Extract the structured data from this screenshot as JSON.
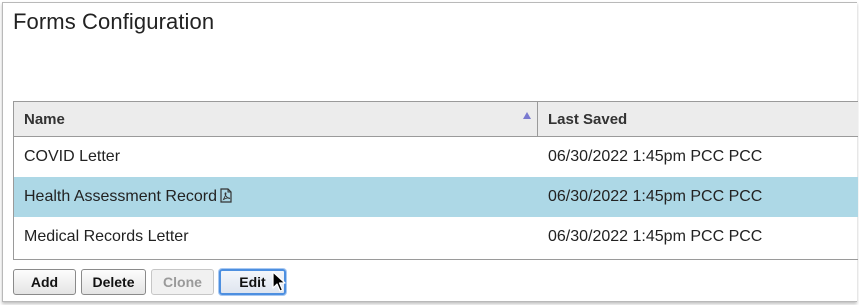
{
  "page": {
    "title": "Forms Configuration"
  },
  "table": {
    "columns": [
      {
        "label": "Name",
        "sort": "ascending"
      },
      {
        "label": "Last Saved"
      }
    ],
    "rows": [
      {
        "name": "COVID Letter",
        "last_saved": "06/30/2022 1:45pm PCC PCC",
        "selected": false,
        "icon": null
      },
      {
        "name": "Health Assessment Record",
        "last_saved": "06/30/2022 1:45pm PCC PCC",
        "selected": true,
        "icon": "pdf-icon"
      },
      {
        "name": "Medical Records Letter",
        "last_saved": "06/30/2022 1:45pm PCC PCC",
        "selected": false,
        "icon": null
      }
    ]
  },
  "toolbar": {
    "add_label": "Add",
    "delete_label": "Delete",
    "clone_label": "Clone",
    "edit_label": "Edit"
  },
  "colors": {
    "selected_row": "#add8e6",
    "header_bg": "#ececec",
    "focus_ring": "#4d8fe0",
    "sort_arrow": "#7a7ad0"
  }
}
